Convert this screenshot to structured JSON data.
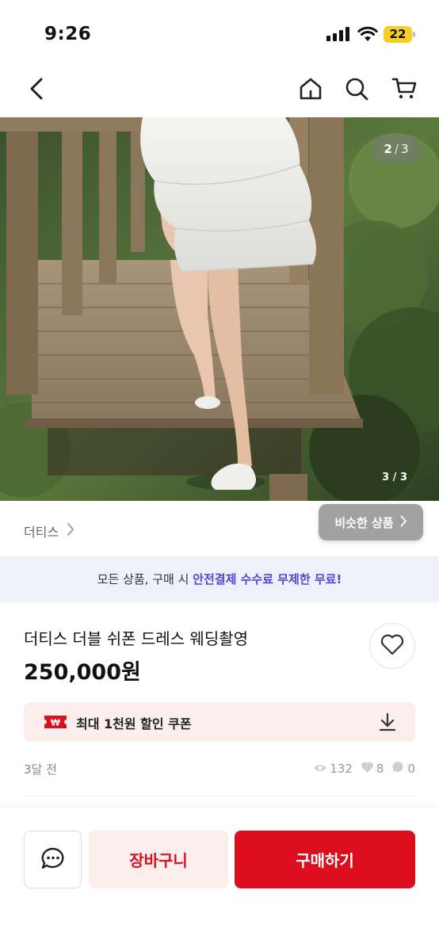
{
  "status_bar": {
    "time": "9:26",
    "battery": "22",
    "icons": [
      "signal-icon",
      "wifi-icon",
      "battery-icon"
    ]
  },
  "nav": {
    "icons": [
      "back-arrow-icon",
      "home-icon",
      "search-icon",
      "cart-icon"
    ]
  },
  "image": {
    "page_current": "2",
    "page_total": "3",
    "page_indicator_small": "3 / 3"
  },
  "shop": {
    "name": "더티스",
    "similar_label": "비슷한 상품"
  },
  "promo": {
    "prefix": "모든 상품, 구매 시 ",
    "highlight": "안전결제 수수료 무제한 무료!"
  },
  "product": {
    "title": "더티스 더블 쉬폰 드레스 웨딩촬영",
    "price": "250,000원"
  },
  "coupon": {
    "label": "최대 1천원 할인 쿠폰"
  },
  "meta": {
    "posted": "3달 전",
    "views": "132",
    "likes": "8",
    "chats": "0"
  },
  "actions": {
    "cart_label": "장바구니",
    "buy_label": "구매하기"
  },
  "colors": {
    "accent_red": "#dc0d1d",
    "promo_purple": "#5046d8",
    "promo_bg": "#eef0fa",
    "coupon_bg": "#fdeeee"
  }
}
